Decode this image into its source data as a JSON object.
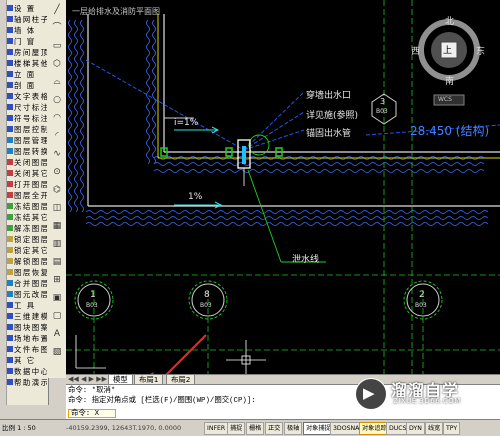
{
  "app": {
    "title": "一层给排水及消防平面图"
  },
  "sidebar": {
    "items": [
      {
        "label": "设  置",
        "color": "#3050c0"
      },
      {
        "label": "轴网柱子",
        "color": "#3050c0"
      },
      {
        "label": "墙  体",
        "color": "#3050c0"
      },
      {
        "label": "门  窗",
        "color": "#3050c0"
      },
      {
        "label": "房间屋顶",
        "color": "#3050c0"
      },
      {
        "label": "楼梯其他",
        "color": "#3050c0"
      },
      {
        "label": "立  面",
        "color": "#3050c0"
      },
      {
        "label": "剖  面",
        "color": "#3050c0"
      },
      {
        "label": "文字表格",
        "color": "#3050c0"
      },
      {
        "label": "尺寸标注",
        "color": "#3050c0"
      },
      {
        "label": "符号标注",
        "color": "#3050c0"
      },
      {
        "label": "图层控制",
        "color": "#3050c0"
      },
      {
        "label": "图层管理",
        "color": "#2080c0"
      },
      {
        "label": "图层转换",
        "color": "#2080c0"
      },
      {
        "label": "关闭图层",
        "color": "#c04040"
      },
      {
        "label": "关闭其它",
        "color": "#c04040"
      },
      {
        "label": "打开图层",
        "color": "#c04040"
      },
      {
        "label": "图层全开",
        "color": "#c04040"
      },
      {
        "label": "冻结图层",
        "color": "#40a040"
      },
      {
        "label": "冻结其它",
        "color": "#40a040"
      },
      {
        "label": "解冻图层",
        "color": "#40a040"
      },
      {
        "label": "锁定图层",
        "color": "#c0a040"
      },
      {
        "label": "锁定其它",
        "color": "#c0a040"
      },
      {
        "label": "解锁图层",
        "color": "#c0a040"
      },
      {
        "label": "图层恢复",
        "color": "#c0a040"
      },
      {
        "label": "合并图层",
        "color": "#2080c0"
      },
      {
        "label": "图元改层",
        "color": "#2080c0"
      },
      {
        "label": "工  具",
        "color": "#3050c0"
      },
      {
        "label": "三维建模",
        "color": "#3050c0"
      },
      {
        "label": "图块图案",
        "color": "#3050c0"
      },
      {
        "label": "场地布置",
        "color": "#3050c0"
      },
      {
        "label": "文件布图",
        "color": "#3050c0"
      },
      {
        "label": "其  它",
        "color": "#3050c0"
      },
      {
        "label": "数据中心",
        "color": "#3050c0"
      },
      {
        "label": "帮助演示",
        "color": "#3050c0"
      }
    ]
  },
  "toolbar": {
    "tools": [
      "╱",
      "⌒",
      "▭",
      "⬡",
      "⌓",
      "○",
      "◠",
      "◜",
      "∿",
      "⊙",
      "⌬",
      "◫",
      "▦",
      "▥",
      "▤",
      "⊞",
      "▣",
      "▢",
      "A",
      "▧"
    ]
  },
  "canvas": {
    "compass": {
      "north": "北",
      "south": "南",
      "east": "东",
      "west": "西",
      "center": "上",
      "wcs": "WCS"
    },
    "labels": {
      "l1": "穿墙出水口",
      "l2": "详见施(参照)",
      "l3": "锚固出水管",
      "elev": "28.450 (结构)",
      "slope1": "i=1%",
      "slope2": "1%",
      "drain": "泄水线",
      "axis3": "3",
      "axis1": "1",
      "axis8": "8",
      "axis2": "2",
      "axisTag": "B03"
    }
  },
  "tabs": {
    "items": [
      "模型",
      "布局1",
      "布局2"
    ]
  },
  "command": {
    "line1": "命令: *取消*",
    "line2": "命令: 指定对角点或 [栏选(F)/圈围(WP)/圈交(CP)]:",
    "prompt": "命令: X"
  },
  "status": {
    "scale": "比例 1 : 50",
    "coords": "-40159.2399, 12643T.1970, 0.0000",
    "buttons": [
      {
        "label": "INFER",
        "on": false
      },
      {
        "label": "捕捉",
        "on": false
      },
      {
        "label": "栅格",
        "on": false
      },
      {
        "label": "正交",
        "on": false
      },
      {
        "label": "极轴",
        "on": false
      },
      {
        "label": "对象捕捉",
        "on": true
      },
      {
        "label": "3DOSNAP",
        "on": false
      },
      {
        "label": "对象追踪",
        "on": true
      },
      {
        "label": "DUCS",
        "on": false
      },
      {
        "label": "DYN",
        "on": false
      },
      {
        "label": "线宽",
        "on": false
      },
      {
        "label": "TPY",
        "on": false
      }
    ]
  },
  "watermark": {
    "title": "溜溜自学",
    "url": "ZIXUE.3D66.COM"
  }
}
